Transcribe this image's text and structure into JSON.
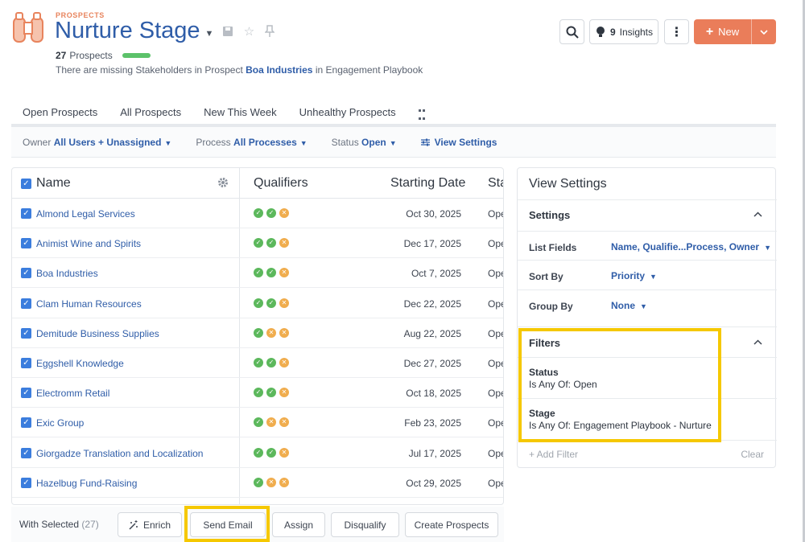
{
  "header": {
    "eyebrow": "PROSPECTS",
    "title": "Nurture Stage",
    "count_label": "27",
    "count_suffix": "Prospects",
    "warning_prefix": "There are missing Stakeholders in Prospect",
    "warning_entity": "Boa Industries",
    "warning_mid": "in",
    "warning_playbook": "Engagement Playbook",
    "insights_count": "9",
    "insights_label": "Insights",
    "new_label": "New"
  },
  "tabs": [
    "Open Prospects",
    "All Prospects",
    "New This Week",
    "Unhealthy Prospects"
  ],
  "filters": {
    "owner_label": "Owner",
    "owner_value": "All Users + Unassigned",
    "process_label": "Process",
    "process_value": "All Processes",
    "status_label": "Status",
    "status_value": "Open",
    "view_settings_label": "View Settings"
  },
  "table": {
    "columns": {
      "name": "Name",
      "qualifiers": "Qualifiers",
      "starting_date": "Starting Date",
      "status": "Sta"
    },
    "rows": [
      {
        "name": "Almond Legal Services",
        "q": [
          "ok",
          "ok",
          "warn"
        ],
        "date": "Oct 30, 2025",
        "status": "Ope"
      },
      {
        "name": "Animist Wine and Spirits",
        "q": [
          "ok",
          "ok",
          "warn"
        ],
        "date": "Dec 17, 2025",
        "status": "Ope"
      },
      {
        "name": "Boa Industries",
        "q": [
          "ok",
          "ok",
          "warn"
        ],
        "date": "Oct 7, 2025",
        "status": "Ope"
      },
      {
        "name": "Clam Human Resources",
        "q": [
          "ok",
          "ok",
          "warn"
        ],
        "date": "Dec 22, 2025",
        "status": "Ope"
      },
      {
        "name": "Demitude Business Supplies",
        "q": [
          "ok",
          "warn",
          "warn"
        ],
        "date": "Aug 22, 2025",
        "status": "Ope"
      },
      {
        "name": "Eggshell Knowledge",
        "q": [
          "ok",
          "ok",
          "warn"
        ],
        "date": "Dec 27, 2025",
        "status": "Ope"
      },
      {
        "name": "Electromm Retail",
        "q": [
          "ok",
          "ok",
          "warn"
        ],
        "date": "Oct 18, 2025",
        "status": "Ope"
      },
      {
        "name": "Exic Group",
        "q": [
          "ok",
          "warn",
          "warn"
        ],
        "date": "Feb 23, 2025",
        "status": "Ope"
      },
      {
        "name": "Giorgadze Translation and Localization",
        "q": [
          "ok",
          "ok",
          "warn"
        ],
        "date": "Jul 17, 2025",
        "status": "Ope"
      },
      {
        "name": "Hazelbug Fund-Raising",
        "q": [
          "ok",
          "warn",
          "warn"
        ],
        "date": "Oct 29, 2025",
        "status": "Ope"
      }
    ]
  },
  "bulk": {
    "with_selected": "With Selected",
    "count": "(27)",
    "enrich": "Enrich",
    "send_email": "Send Email",
    "assign": "Assign",
    "disqualify": "Disqualify",
    "create_prospects": "Create Prospects"
  },
  "view_settings": {
    "title": "View Settings",
    "settings_header": "Settings",
    "list_fields_label": "List Fields",
    "list_fields_value": "Name, Qualifie...Process, Owner",
    "sort_by_label": "Sort By",
    "sort_by_value": "Priority",
    "group_by_label": "Group By",
    "group_by_value": "None",
    "filters_header": "Filters",
    "status_filter_label": "Status",
    "status_filter_value": "Is Any Of: Open",
    "stage_filter_label": "Stage",
    "stage_filter_value": "Is Any Of: Engagement Playbook - Nurture",
    "add_filter": "+ Add Filter",
    "clear": "Clear"
  },
  "colors": {
    "accent": "#ea7d5a",
    "link": "#2f5da8",
    "highlight": "#f5c800",
    "ok": "#5cb85c",
    "warn": "#f0ad4e"
  }
}
